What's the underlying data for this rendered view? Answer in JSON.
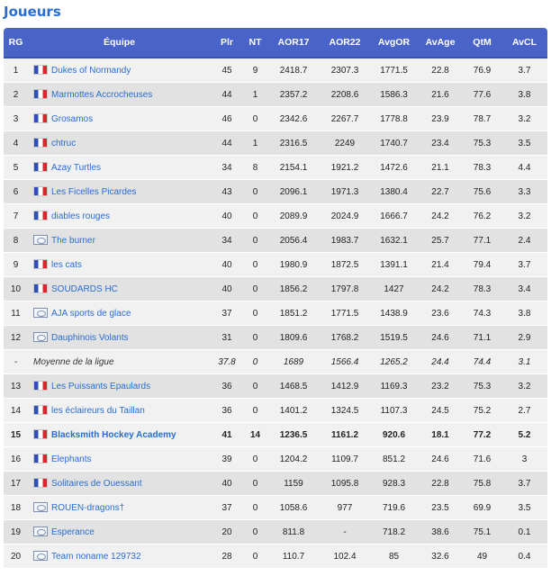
{
  "page": {
    "title": "Joueurs"
  },
  "table": {
    "headers": {
      "rank": "RG",
      "team": "Équipe",
      "plr": "Plr",
      "nt": "NT",
      "aor17": "AOR17",
      "aor22": "AOR22",
      "avgor": "AvgOR",
      "avage": "AvAge",
      "qtm": "QtM",
      "avcl": "AvCL"
    },
    "rows": [
      {
        "rank": "1",
        "flag": "france-flag",
        "team": "Dukes of Normandy",
        "plr": "45",
        "nt": "9",
        "aor17": "2418.7",
        "aor22": "2307.3",
        "avgor": "1771.5",
        "avage": "22.8",
        "qtm": "76.9",
        "avcl": "3.7"
      },
      {
        "rank": "2",
        "flag": "france-flag",
        "team": "Marmottes Accrocheuses",
        "plr": "44",
        "nt": "1",
        "aor17": "2357.2",
        "aor22": "2208.6",
        "avgor": "1586.3",
        "avage": "21.6",
        "qtm": "77.6",
        "avcl": "3.8"
      },
      {
        "rank": "3",
        "flag": "france-flag",
        "team": "Grosamos",
        "plr": "46",
        "nt": "0",
        "aor17": "2342.6",
        "aor22": "2267.7",
        "avgor": "1778.8",
        "avage": "23.9",
        "qtm": "78.7",
        "avcl": "3.2"
      },
      {
        "rank": "4",
        "flag": "france-flag",
        "team": "chtruc",
        "plr": "44",
        "nt": "1",
        "aor17": "2316.5",
        "aor22": "2249",
        "avgor": "1740.7",
        "avage": "23.4",
        "qtm": "75.3",
        "avcl": "3.5"
      },
      {
        "rank": "5",
        "flag": "france-flag",
        "team": "Azay Turtles",
        "plr": "34",
        "nt": "8",
        "aor17": "2154.1",
        "aor22": "1921.2",
        "avgor": "1472.6",
        "avage": "21.1",
        "qtm": "78.3",
        "avcl": "4.4"
      },
      {
        "rank": "6",
        "flag": "france-flag",
        "team": "Les Ficelles Picardes",
        "plr": "43",
        "nt": "0",
        "aor17": "2096.1",
        "aor22": "1971.3",
        "avgor": "1380.4",
        "avage": "22.7",
        "qtm": "75.6",
        "avcl": "3.3"
      },
      {
        "rank": "7",
        "flag": "france-flag",
        "team": "diables rouges",
        "plr": "40",
        "nt": "0",
        "aor17": "2089.9",
        "aor22": "2024.9",
        "avgor": "1666.7",
        "avage": "24.2",
        "qtm": "76.2",
        "avcl": "3.2"
      },
      {
        "rank": "8",
        "flag": "international-flag",
        "team": "The burner",
        "plr": "34",
        "nt": "0",
        "aor17": "2056.4",
        "aor22": "1983.7",
        "avgor": "1632.1",
        "avage": "25.7",
        "qtm": "77.1",
        "avcl": "2.4"
      },
      {
        "rank": "9",
        "flag": "france-flag",
        "team": "les cats",
        "plr": "40",
        "nt": "0",
        "aor17": "1980.9",
        "aor22": "1872.5",
        "avgor": "1391.1",
        "avage": "21.4",
        "qtm": "79.4",
        "avcl": "3.7"
      },
      {
        "rank": "10",
        "flag": "france-flag",
        "team": "SOUDARDS HC",
        "plr": "40",
        "nt": "0",
        "aor17": "1856.2",
        "aor22": "1797.8",
        "avgor": "1427",
        "avage": "24.2",
        "qtm": "78.3",
        "avcl": "3.4"
      },
      {
        "rank": "11",
        "flag": "international-flag",
        "team": "AJA sports de glace",
        "plr": "37",
        "nt": "0",
        "aor17": "1851.2",
        "aor22": "1771.5",
        "avgor": "1438.9",
        "avage": "23.6",
        "qtm": "74.3",
        "avcl": "3.8"
      },
      {
        "rank": "12",
        "flag": "international-flag",
        "team": "Dauphinois Volants",
        "plr": "31",
        "nt": "0",
        "aor17": "1809.6",
        "aor22": "1768.2",
        "avgor": "1519.5",
        "avage": "24.6",
        "qtm": "71.1",
        "avcl": "2.9"
      },
      {
        "rank": "-",
        "flag": "",
        "team": "Moyenne de la ligue",
        "plr": "37.8",
        "nt": "0",
        "aor17": "1689",
        "aor22": "1566.4",
        "avgor": "1265.2",
        "avage": "24.4",
        "qtm": "74.4",
        "avcl": "3.1",
        "league": true
      },
      {
        "rank": "13",
        "flag": "france-flag",
        "team": "Les Puissants Epaulards",
        "plr": "36",
        "nt": "0",
        "aor17": "1468.5",
        "aor22": "1412.9",
        "avgor": "1169.3",
        "avage": "23.2",
        "qtm": "75.3",
        "avcl": "3.2"
      },
      {
        "rank": "14",
        "flag": "france-flag",
        "team": "les éclaireurs du Taillan",
        "plr": "36",
        "nt": "0",
        "aor17": "1401.2",
        "aor22": "1324.5",
        "avgor": "1107.3",
        "avage": "24.5",
        "qtm": "75.2",
        "avcl": "2.7"
      },
      {
        "rank": "15",
        "flag": "france-flag",
        "team": "Blacksmith Hockey Academy",
        "plr": "41",
        "nt": "14",
        "aor17": "1236.5",
        "aor22": "1161.2",
        "avgor": "920.6",
        "avage": "18.1",
        "qtm": "77.2",
        "avcl": "5.2",
        "highlight": true
      },
      {
        "rank": "16",
        "flag": "france-flag",
        "team": "Elephants",
        "plr": "39",
        "nt": "0",
        "aor17": "1204.2",
        "aor22": "1109.7",
        "avgor": "851.2",
        "avage": "24.6",
        "qtm": "71.6",
        "avcl": "3"
      },
      {
        "rank": "17",
        "flag": "france-flag",
        "team": "Solitaires de Ouessant",
        "plr": "40",
        "nt": "0",
        "aor17": "1159",
        "aor22": "1095.8",
        "avgor": "928.3",
        "avage": "22.8",
        "qtm": "75.8",
        "avcl": "3.7"
      },
      {
        "rank": "18",
        "flag": "international-flag",
        "team": "ROUEN-dragons†",
        "plr": "37",
        "nt": "0",
        "aor17": "1058.6",
        "aor22": "977",
        "avgor": "719.6",
        "avage": "23.5",
        "qtm": "69.9",
        "avcl": "3.5"
      },
      {
        "rank": "19",
        "flag": "international-flag",
        "team": "Esperance",
        "plr": "20",
        "nt": "0",
        "aor17": "811.8",
        "aor22": "-",
        "avgor": "718.2",
        "avage": "38.6",
        "qtm": "75.1",
        "avcl": "0.1"
      },
      {
        "rank": "20",
        "flag": "international-flag",
        "team": "Team noname 129732",
        "plr": "28",
        "nt": "0",
        "aor17": "110.7",
        "aor22": "102.4",
        "avgor": "85",
        "avage": "32.6",
        "qtm": "49",
        "avcl": "0.4"
      }
    ]
  }
}
